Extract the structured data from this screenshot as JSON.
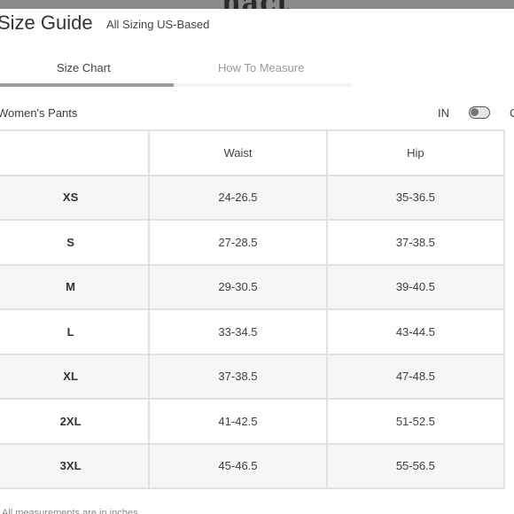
{
  "backdrop": {
    "brand_text": "nact"
  },
  "header": {
    "title": "Size Guide",
    "subtitle": "All Sizing US-Based"
  },
  "tabs": [
    {
      "label": "Size Chart",
      "active": true
    },
    {
      "label": "How To Measure",
      "active": false
    }
  ],
  "section": {
    "label": "Women's Pants",
    "unit_in": "IN",
    "unit_cm": "CM",
    "unit_toggle_state": "IN"
  },
  "table": {
    "headers": [
      "",
      "Waist",
      "Hip"
    ],
    "rows": [
      {
        "size": "XS",
        "waist": "24-26.5",
        "hip": "35-36.5"
      },
      {
        "size": "S",
        "waist": "27-28.5",
        "hip": "37-38.5"
      },
      {
        "size": "M",
        "waist": "29-30.5",
        "hip": "39-40.5"
      },
      {
        "size": "L",
        "waist": "33-34.5",
        "hip": "43-44.5"
      },
      {
        "size": "XL",
        "waist": "37-38.5",
        "hip": "47-48.5"
      },
      {
        "size": "2XL",
        "waist": "41-42.5",
        "hip": "51-52.5"
      },
      {
        "size": "3XL",
        "waist": "45-46.5",
        "hip": "55-56.5"
      }
    ]
  },
  "footnote": "All measurements are in inches",
  "colors": {
    "active_tab_indicator": "#9e9e9e",
    "row_shade": "#f6f6f6",
    "grid_line": "#e2e2e2",
    "backdrop": "#8a8a8a"
  },
  "icons": [
    "toggle-switch"
  ]
}
